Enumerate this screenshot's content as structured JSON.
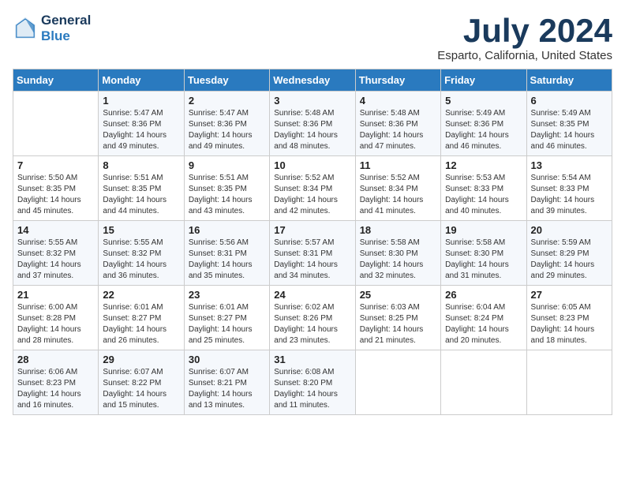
{
  "header": {
    "logo_line1": "General",
    "logo_line2": "Blue",
    "month_title": "July 2024",
    "subtitle": "Esparto, California, United States"
  },
  "days_of_week": [
    "Sunday",
    "Monday",
    "Tuesday",
    "Wednesday",
    "Thursday",
    "Friday",
    "Saturday"
  ],
  "weeks": [
    [
      {
        "day": "",
        "text": ""
      },
      {
        "day": "1",
        "text": "Sunrise: 5:47 AM\nSunset: 8:36 PM\nDaylight: 14 hours\nand 49 minutes."
      },
      {
        "day": "2",
        "text": "Sunrise: 5:47 AM\nSunset: 8:36 PM\nDaylight: 14 hours\nand 49 minutes."
      },
      {
        "day": "3",
        "text": "Sunrise: 5:48 AM\nSunset: 8:36 PM\nDaylight: 14 hours\nand 48 minutes."
      },
      {
        "day": "4",
        "text": "Sunrise: 5:48 AM\nSunset: 8:36 PM\nDaylight: 14 hours\nand 47 minutes."
      },
      {
        "day": "5",
        "text": "Sunrise: 5:49 AM\nSunset: 8:36 PM\nDaylight: 14 hours\nand 46 minutes."
      },
      {
        "day": "6",
        "text": "Sunrise: 5:49 AM\nSunset: 8:35 PM\nDaylight: 14 hours\nand 46 minutes."
      }
    ],
    [
      {
        "day": "7",
        "text": "Sunrise: 5:50 AM\nSunset: 8:35 PM\nDaylight: 14 hours\nand 45 minutes."
      },
      {
        "day": "8",
        "text": "Sunrise: 5:51 AM\nSunset: 8:35 PM\nDaylight: 14 hours\nand 44 minutes."
      },
      {
        "day": "9",
        "text": "Sunrise: 5:51 AM\nSunset: 8:35 PM\nDaylight: 14 hours\nand 43 minutes."
      },
      {
        "day": "10",
        "text": "Sunrise: 5:52 AM\nSunset: 8:34 PM\nDaylight: 14 hours\nand 42 minutes."
      },
      {
        "day": "11",
        "text": "Sunrise: 5:52 AM\nSunset: 8:34 PM\nDaylight: 14 hours\nand 41 minutes."
      },
      {
        "day": "12",
        "text": "Sunrise: 5:53 AM\nSunset: 8:33 PM\nDaylight: 14 hours\nand 40 minutes."
      },
      {
        "day": "13",
        "text": "Sunrise: 5:54 AM\nSunset: 8:33 PM\nDaylight: 14 hours\nand 39 minutes."
      }
    ],
    [
      {
        "day": "14",
        "text": "Sunrise: 5:55 AM\nSunset: 8:32 PM\nDaylight: 14 hours\nand 37 minutes."
      },
      {
        "day": "15",
        "text": "Sunrise: 5:55 AM\nSunset: 8:32 PM\nDaylight: 14 hours\nand 36 minutes."
      },
      {
        "day": "16",
        "text": "Sunrise: 5:56 AM\nSunset: 8:31 PM\nDaylight: 14 hours\nand 35 minutes."
      },
      {
        "day": "17",
        "text": "Sunrise: 5:57 AM\nSunset: 8:31 PM\nDaylight: 14 hours\nand 34 minutes."
      },
      {
        "day": "18",
        "text": "Sunrise: 5:58 AM\nSunset: 8:30 PM\nDaylight: 14 hours\nand 32 minutes."
      },
      {
        "day": "19",
        "text": "Sunrise: 5:58 AM\nSunset: 8:30 PM\nDaylight: 14 hours\nand 31 minutes."
      },
      {
        "day": "20",
        "text": "Sunrise: 5:59 AM\nSunset: 8:29 PM\nDaylight: 14 hours\nand 29 minutes."
      }
    ],
    [
      {
        "day": "21",
        "text": "Sunrise: 6:00 AM\nSunset: 8:28 PM\nDaylight: 14 hours\nand 28 minutes."
      },
      {
        "day": "22",
        "text": "Sunrise: 6:01 AM\nSunset: 8:27 PM\nDaylight: 14 hours\nand 26 minutes."
      },
      {
        "day": "23",
        "text": "Sunrise: 6:01 AM\nSunset: 8:27 PM\nDaylight: 14 hours\nand 25 minutes."
      },
      {
        "day": "24",
        "text": "Sunrise: 6:02 AM\nSunset: 8:26 PM\nDaylight: 14 hours\nand 23 minutes."
      },
      {
        "day": "25",
        "text": "Sunrise: 6:03 AM\nSunset: 8:25 PM\nDaylight: 14 hours\nand 21 minutes."
      },
      {
        "day": "26",
        "text": "Sunrise: 6:04 AM\nSunset: 8:24 PM\nDaylight: 14 hours\nand 20 minutes."
      },
      {
        "day": "27",
        "text": "Sunrise: 6:05 AM\nSunset: 8:23 PM\nDaylight: 14 hours\nand 18 minutes."
      }
    ],
    [
      {
        "day": "28",
        "text": "Sunrise: 6:06 AM\nSunset: 8:23 PM\nDaylight: 14 hours\nand 16 minutes."
      },
      {
        "day": "29",
        "text": "Sunrise: 6:07 AM\nSunset: 8:22 PM\nDaylight: 14 hours\nand 15 minutes."
      },
      {
        "day": "30",
        "text": "Sunrise: 6:07 AM\nSunset: 8:21 PM\nDaylight: 14 hours\nand 13 minutes."
      },
      {
        "day": "31",
        "text": "Sunrise: 6:08 AM\nSunset: 8:20 PM\nDaylight: 14 hours\nand 11 minutes."
      },
      {
        "day": "",
        "text": ""
      },
      {
        "day": "",
        "text": ""
      },
      {
        "day": "",
        "text": ""
      }
    ]
  ]
}
